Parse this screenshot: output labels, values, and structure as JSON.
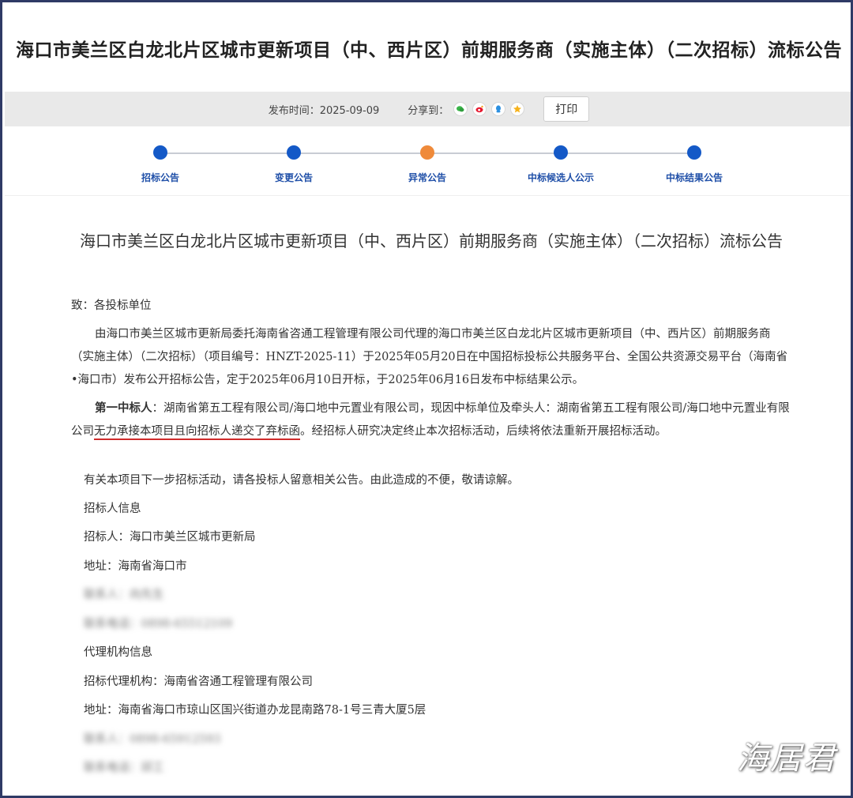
{
  "header": {
    "title": "海口市美兰区白龙北片区城市更新项目（中、西片区）前期服务商（实施主体）（二次招标）流标公告"
  },
  "meta": {
    "publish_label": "发布时间：",
    "publish_date": "2025-09-09",
    "share_label": "分享到：",
    "share_icons": [
      "wechat-icon",
      "weibo-icon",
      "qq-icon",
      "qzone-icon"
    ],
    "print_label": "打印"
  },
  "steps": [
    {
      "label": "招标公告",
      "status": "done",
      "color": "#1459c7"
    },
    {
      "label": "变更公告",
      "status": "done",
      "color": "#1459c7"
    },
    {
      "label": "异常公告",
      "status": "current",
      "color": "#ef8a3a"
    },
    {
      "label": "中标候选人公示",
      "status": "done",
      "color": "#1459c7"
    },
    {
      "label": "中标结果公告",
      "status": "done",
      "color": "#1459c7"
    }
  ],
  "article": {
    "title": "海口市美兰区白龙北片区城市更新项目（中、西片区）前期服务商（实施主体）（二次招标）流标公告",
    "salutation": "致：各投标单位",
    "para1": "由海口市美兰区城市更新局委托海南省咨通工程管理有限公司代理的海口市美兰区白龙北片区城市更新项目（中、西片区）前期服务商（实施主体）（二次招标）（项目编号：HNZT-2025-11）于2025年05月20日在中国招标投标公共服务平台、全国公共资源交易平台（海南省•海口市）发布公开招标公告，定于2025年06月10日开标，于2025年06月16日发布中标结果公示。",
    "para2_bold": "第一中标人",
    "para2_a": "：湖南省第五工程有限公司/海口地中元置业有限公司，现因中标单位及牵头人：湖南省第五工程有限公司/海口地中元置业有限公司",
    "para2_underlined": "无力承接本项目且向招标人递交了弃标函",
    "para2_b": "。经招标人研究决定终止本次招标活动，后续将依法重新开展招标活动。",
    "para3": "有关本项目下一步招标活动，请各投标人留意相关公告。由此造成的不便，敬请谅解。",
    "tenderer_info_heading": "招标人信息",
    "tenderer": "招标人：海口市美兰区城市更新局",
    "tenderer_address": "地址：海南省海口市",
    "tenderer_contact_blurred": "联系人：向先生",
    "tenderer_phone_blurred": "联系电话：0898-65512109",
    "agency_info_heading": "代理机构信息",
    "agency": "招标代理机构：海南省咨通工程管理有限公司",
    "agency_address": "地址：海南省海口市琼山区国兴街道办龙昆南路78-1号三青大厦5层",
    "agency_contact_blurred": "联系人：0898-65912593",
    "agency_phone_blurred": "联系电话：邱工"
  },
  "watermark": "海居君"
}
